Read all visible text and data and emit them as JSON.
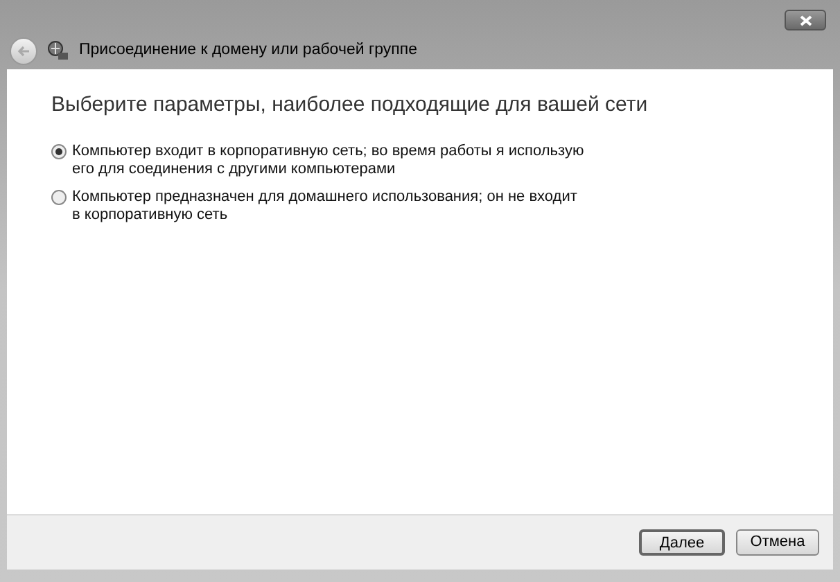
{
  "window": {
    "title": "Присоединение к домену или рабочей группе"
  },
  "heading": "Выберите параметры, наиболее подходящие для вашей сети",
  "options": [
    {
      "label": "Компьютер входит в корпоративную сеть; во время работы я использую его для соединения с другими компьютерами",
      "selected": true
    },
    {
      "label": "Компьютер предназначен для домашнего использования; он не входит в корпоративную сеть",
      "selected": false
    }
  ],
  "buttons": [
    {
      "label": "Далее",
      "default": true
    },
    {
      "label": "Отмена",
      "default": false
    }
  ]
}
